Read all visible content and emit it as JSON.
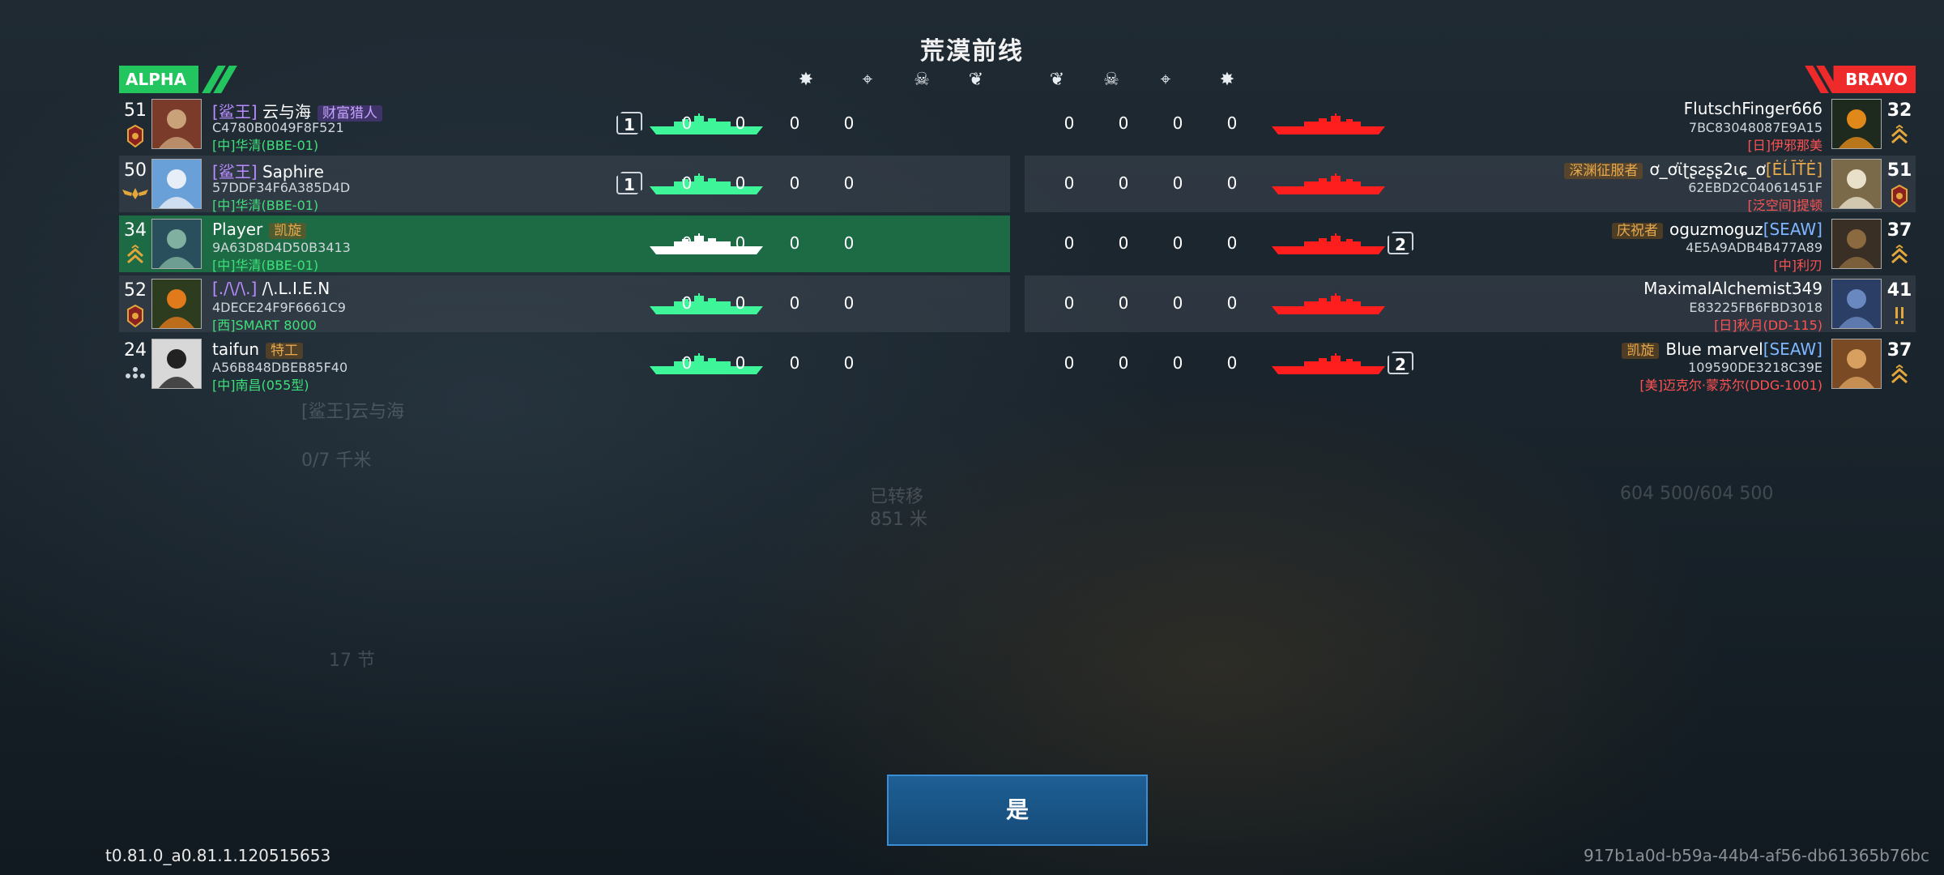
{
  "map_title": "荒漠前线",
  "teams": {
    "alpha": "ALPHA",
    "bravo": "BRAVO"
  },
  "columns": [
    "damage-icon",
    "target-icon",
    "kill-icon",
    "assist-icon"
  ],
  "colors": {
    "alpha": "#22c55e",
    "bravo": "#ef2a2a",
    "highlight": "#1c6b45",
    "button": "#1e5f94"
  },
  "alpha_players": [
    {
      "level": "51",
      "rank_icon": "badge-red",
      "clan": "[鲨王]",
      "name": "云与海",
      "title": "财富猎人",
      "title_style": "purple",
      "id": "C4780B0049F8F521",
      "ship": "[中]华清(BBE-01)",
      "kill_badge": "1",
      "scores": [
        "0",
        "0",
        "0",
        "0"
      ]
    },
    {
      "level": "50",
      "rank_icon": "wings",
      "clan": "[鲨王]",
      "name": "Saphire",
      "title": "",
      "title_style": "",
      "id": "57DDF34F6A385D4D",
      "ship": "[中]华清(BBE-01)",
      "kill_badge": "1",
      "scores": [
        "0",
        "0",
        "0",
        "0"
      ]
    },
    {
      "level": "34",
      "rank_icon": "chevron-gold",
      "clan": "",
      "name": "Player",
      "title": "凯旋",
      "title_style": "gold",
      "id": "9A63D8D4D50B3413",
      "ship": "[中]华清(BBE-01)",
      "kill_badge": "",
      "scores": [
        "0",
        "0",
        "0",
        "0"
      ],
      "highlight": true
    },
    {
      "level": "52",
      "rank_icon": "badge-red",
      "clan": "[./\\/\\.]",
      "name": "/\\.L.I.E.N",
      "title": "",
      "title_style": "",
      "id": "4DECE24F9F6661C9",
      "ship": "[西]SMART 8000",
      "kill_badge": "",
      "scores": [
        "0",
        "0",
        "0",
        "0"
      ]
    },
    {
      "level": "24",
      "rank_icon": "stars",
      "clan": "",
      "name": "taifun",
      "title": "特工",
      "title_style": "gold",
      "id": "A56B848DBEB85F40",
      "ship": "[中]南昌(055型)",
      "kill_badge": "",
      "scores": [
        "0",
        "0",
        "0",
        "0"
      ]
    }
  ],
  "bravo_players": [
    {
      "level": "32",
      "rank_icon": "chevron-gold",
      "clan": "",
      "name": "FlutschFinger666",
      "title": "",
      "title_style": "",
      "id": "7BC83048087E9A15",
      "ship": "[日]伊邪那美",
      "kill_badge": "",
      "scores": [
        "0",
        "0",
        "0",
        "0"
      ]
    },
    {
      "level": "51",
      "rank_icon": "badge-red",
      "clan": "[ĖĹĪŤĖ]",
      "name": "ơ_ơɩ̈ʈʂƨʂʂ2ɩɕ_ơ",
      "title": "深渊征服者",
      "title_style": "gold",
      "id": "62EBD2C04061451F",
      "ship": "[泛空间]提顿",
      "kill_badge": "",
      "scores": [
        "0",
        "0",
        "0",
        "0"
      ]
    },
    {
      "level": "37",
      "rank_icon": "chevron-gold",
      "clan": "[SEAW]",
      "name": "oguzmoguz",
      "title": "庆祝者",
      "title_style": "gold",
      "id": "4E5A9ADB4B477A89",
      "ship": "[中]利刃",
      "kill_badge": "2",
      "scores": [
        "0",
        "0",
        "0",
        "0"
      ]
    },
    {
      "level": "41",
      "rank_icon": "exclaim",
      "clan": "",
      "name": "MaximalAlchemist349",
      "title": "",
      "title_style": "",
      "id": "E83225FB6FBD3018",
      "ship": "[日]秋月(DD-115)",
      "kill_badge": "",
      "scores": [
        "0",
        "0",
        "0",
        "0"
      ]
    },
    {
      "level": "37",
      "rank_icon": "chevron-gold",
      "clan": "[SEAW]",
      "name": "Blue marvel",
      "title": "凯旋",
      "title_style": "gold",
      "id": "109590DE3218C39E",
      "ship": "[美]迈克尔·蒙苏尔(DDG-1001)",
      "kill_badge": "2",
      "scores": [
        "0",
        "0",
        "0",
        "0"
      ]
    }
  ],
  "confirm_button": "是",
  "version": "t0.81.0_a0.81.1.120515653",
  "session_id": "917b1a0d-b59a-44b4-af56-db61365b76bc"
}
